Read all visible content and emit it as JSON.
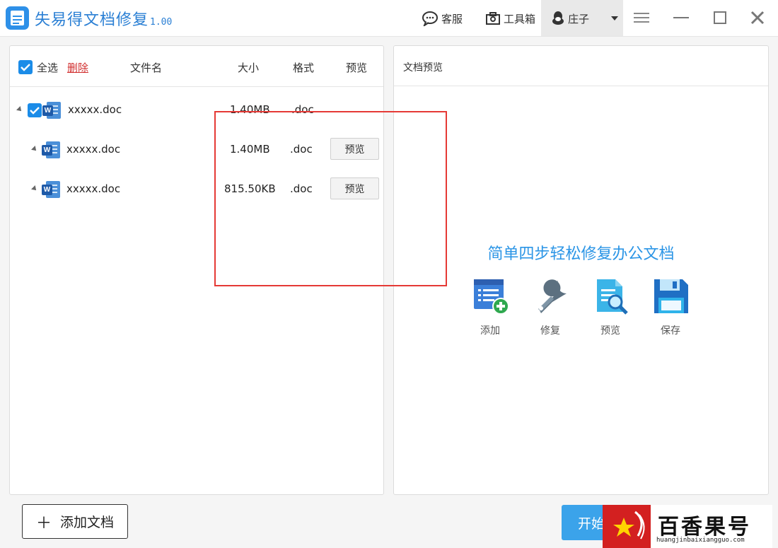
{
  "titlebar": {
    "app_name": "失易得文档修复",
    "version": "1.00",
    "customer_service_label": "客服",
    "toolbox_label": "工具箱",
    "user_name": "庄子"
  },
  "file_list": {
    "select_all_label": "全选",
    "delete_label": "删除",
    "columns": {
      "name": "文件名",
      "size": "大小",
      "format": "格式",
      "preview": "预览"
    },
    "rows": [
      {
        "name": "xxxxx.doc",
        "size": "1.40MB",
        "format": ".doc",
        "checked": true,
        "level": 0
      },
      {
        "name": "xxxxx.doc",
        "size": "1.40MB",
        "format": ".doc",
        "preview_label": "预览",
        "level": 1
      },
      {
        "name": "xxxxx.doc",
        "size": "815.50KB",
        "format": ".doc",
        "preview_label": "预览",
        "level": 1
      }
    ]
  },
  "preview_panel": {
    "title": "文档预览",
    "headline": "简单四步轻松修复办公文档",
    "steps": [
      {
        "label": "添加",
        "icon": "add-list-icon"
      },
      {
        "label": "修复",
        "icon": "wrench-icon"
      },
      {
        "label": "预览",
        "icon": "document-magnifier-icon"
      },
      {
        "label": "保存",
        "icon": "floppy-disk-icon"
      }
    ]
  },
  "bottom": {
    "add_doc_label": "添加文档",
    "start_label": "开始"
  },
  "watermark": {
    "text": "百香果号",
    "url": "huangjinbaixiangguo.com"
  },
  "colors": {
    "accent": "#2b95e6",
    "highlight": "#e53935",
    "delete": "#d12f2f"
  }
}
